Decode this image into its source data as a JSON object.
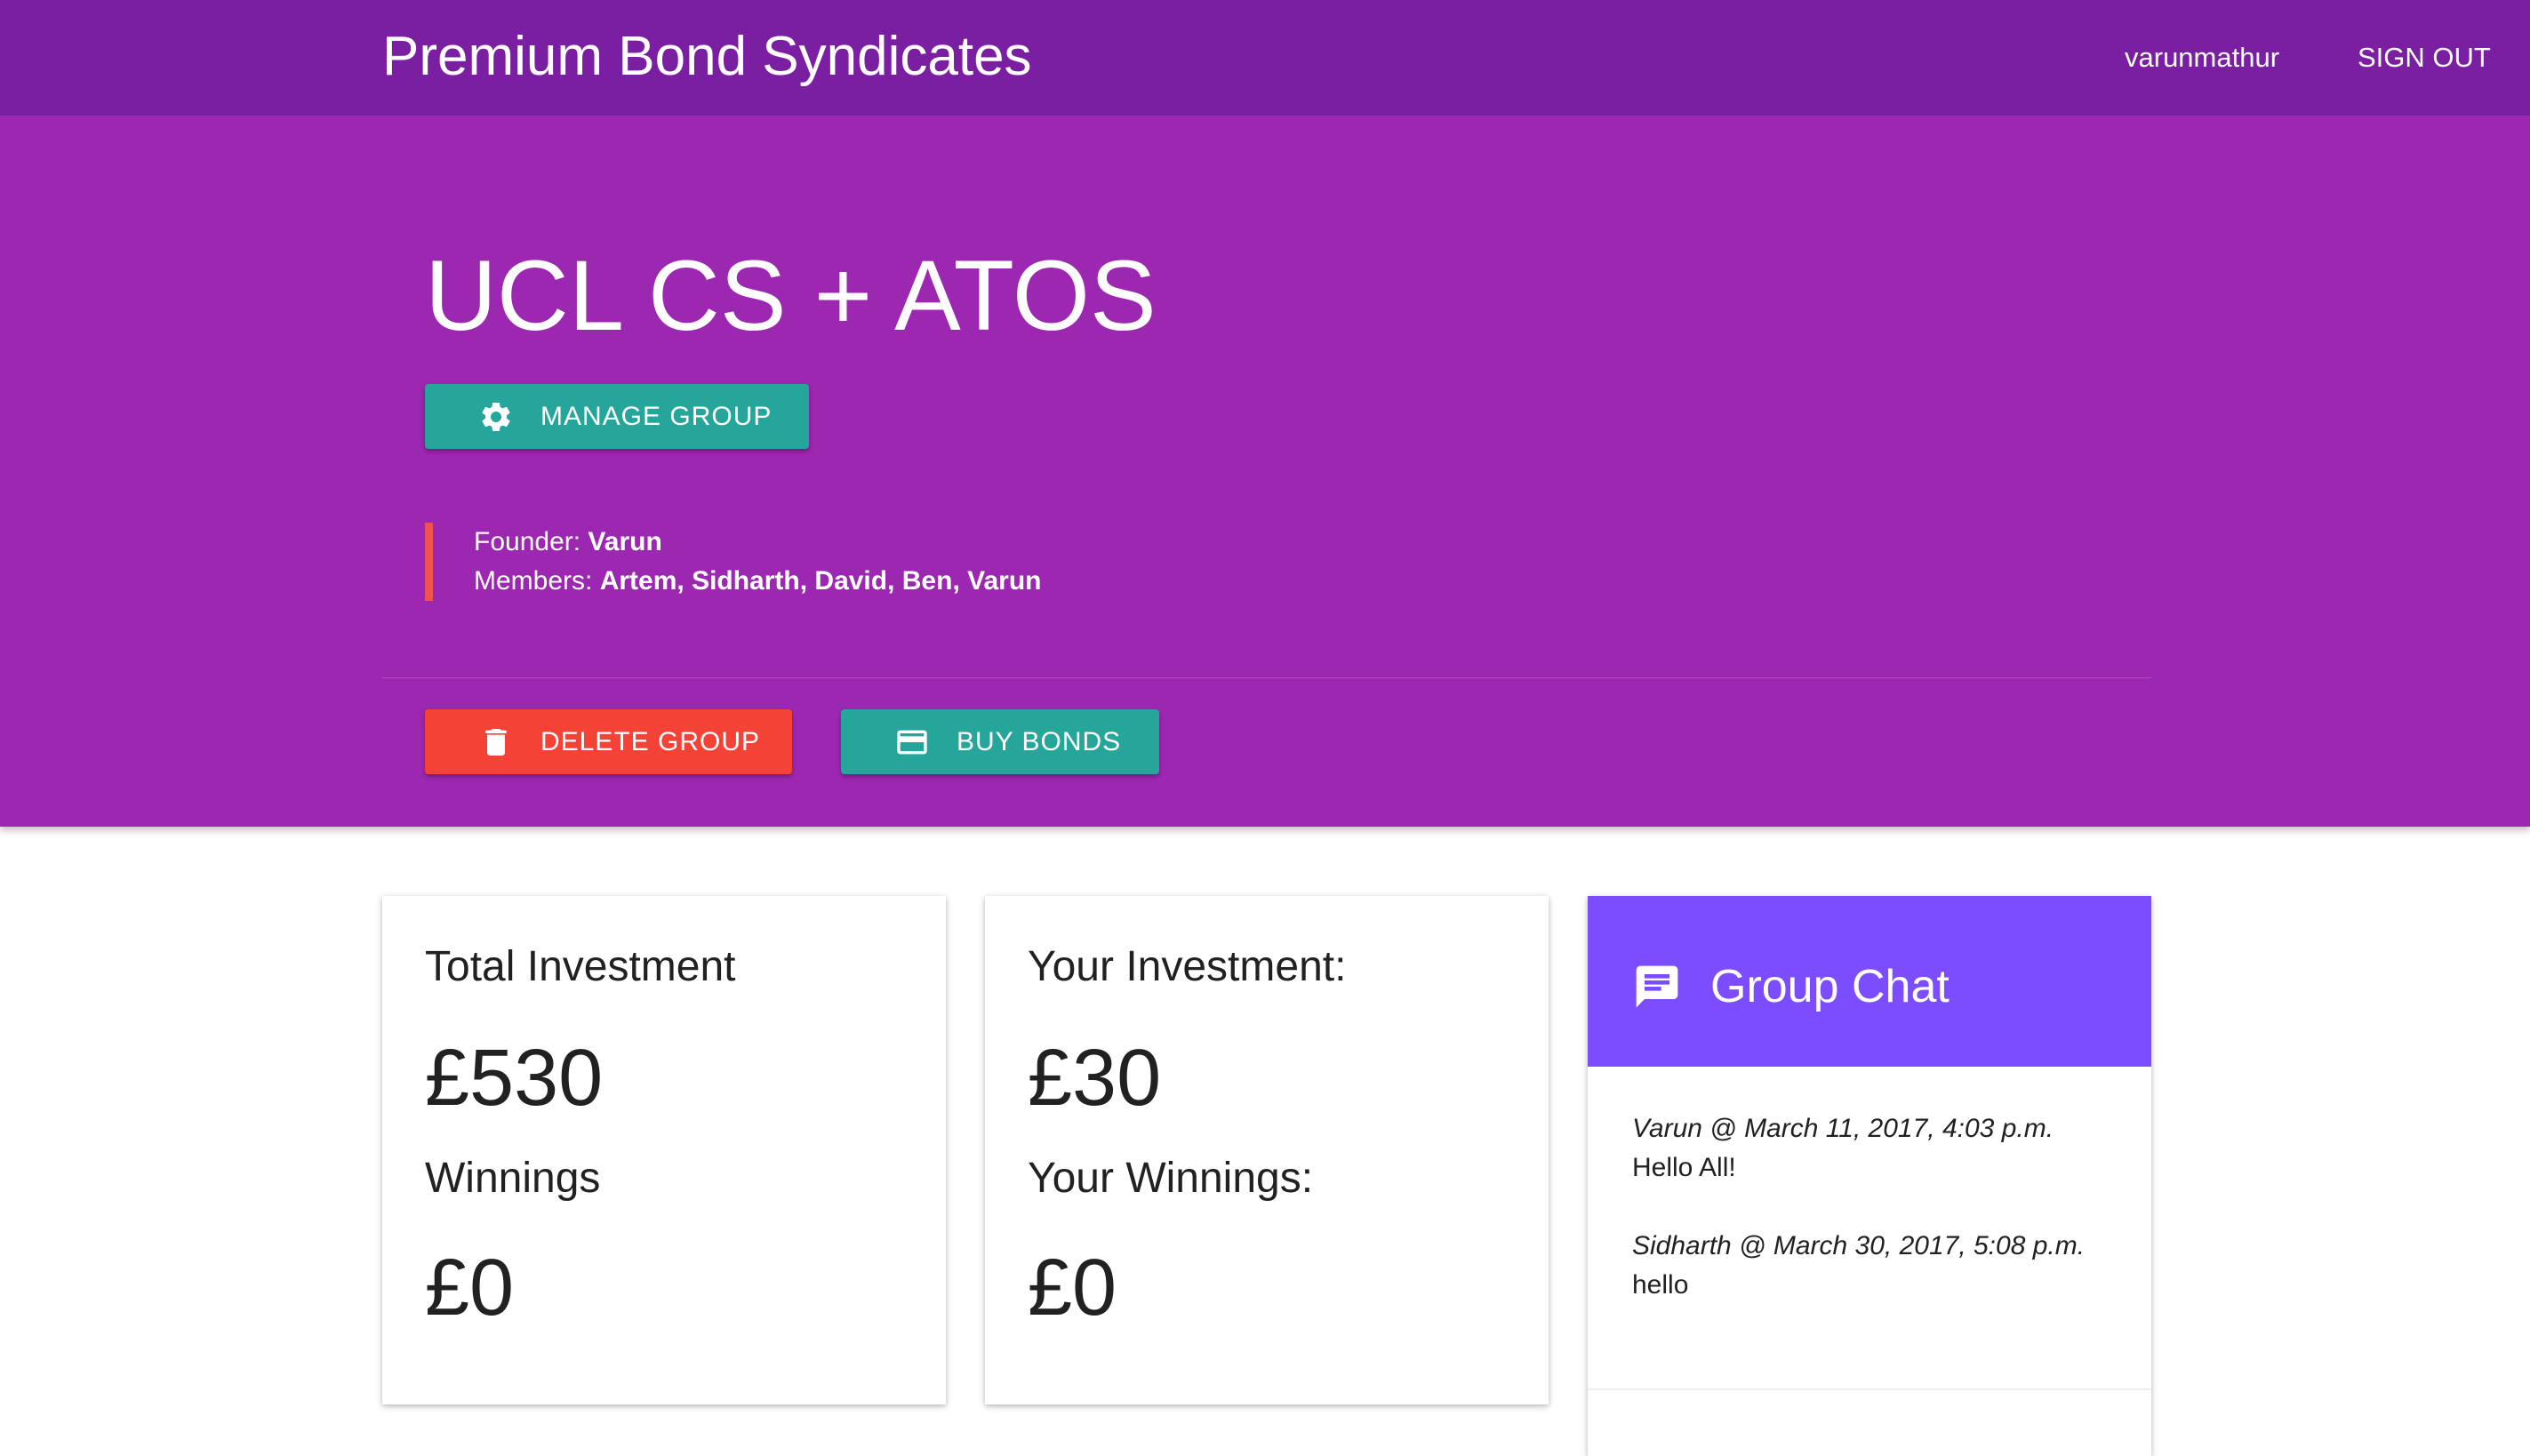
{
  "navbar": {
    "brand": "Premium Bond Syndicates",
    "username": "varunmathur",
    "sign_out": "SIGN OUT"
  },
  "group": {
    "name": "UCL CS + ATOS",
    "manage_label": "MANAGE GROUP",
    "founder_label": "Founder:",
    "founder": "Varun",
    "members_label": "Members:",
    "members": "Artem, Sidharth, David, Ben, Varun",
    "delete_label": "DELETE GROUP",
    "buy_label": "BUY BONDS"
  },
  "stats": {
    "total_investment_label": "Total Investment",
    "total_investment": "£530",
    "winnings_label": "Winnings",
    "winnings": "£0",
    "your_investment_label": "Your Investment:",
    "your_investment": "£30",
    "your_winnings_label": "Your Winnings:",
    "your_winnings": "£0"
  },
  "chat": {
    "title": "Group Chat",
    "messages": [
      {
        "meta": "Varun @ March 11, 2017, 4:03 p.m.",
        "text": "Hello All!"
      },
      {
        "meta": "Sidharth @ March 30, 2017, 5:08 p.m.",
        "text": "hello"
      }
    ]
  },
  "colors": {
    "appbar": "#7b1fa2",
    "hero": "#9c27b0",
    "teal": "#26a69a",
    "red": "#f44336",
    "chat_header": "#7c4dff"
  },
  "icons": {
    "manage": "gear-icon",
    "delete": "trash-icon",
    "buy": "credit-card-icon",
    "chat": "chat-bubble-icon"
  }
}
